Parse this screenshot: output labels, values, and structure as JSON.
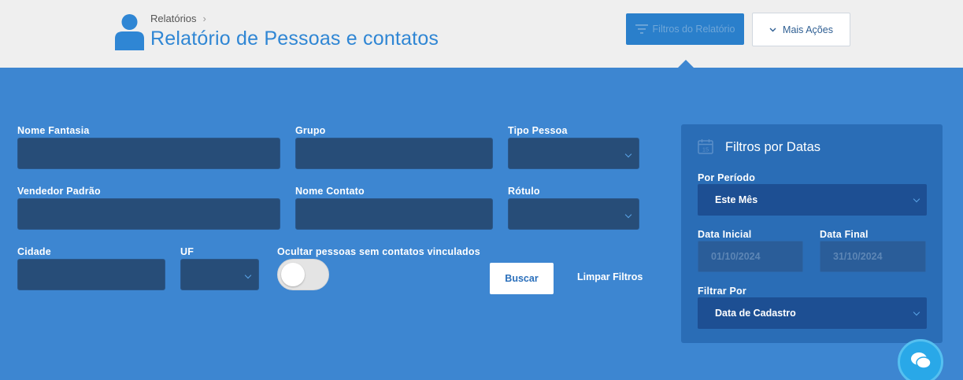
{
  "header": {
    "breadcrumb": "Relatórios",
    "title": "Relatório de Pessoas e contatos",
    "filters_button": "Filtros do Relatório",
    "more_actions_button": "Mais Ações",
    "icons": {
      "avatar": "user-icon",
      "filters": "filter-icon",
      "more": "chevron-down-icon",
      "breadcrumb_sep": "chevron-right-icon"
    }
  },
  "form": {
    "nome_fantasia": {
      "label": "Nome Fantasia",
      "value": ""
    },
    "grupo": {
      "label": "Grupo",
      "value": ""
    },
    "tipo_pessoa": {
      "label": "Tipo Pessoa",
      "value": ""
    },
    "vendedor_padrao": {
      "label": "Vendedor Padrão",
      "value": ""
    },
    "nome_contato": {
      "label": "Nome Contato",
      "value": ""
    },
    "rotulo": {
      "label": "Rótulo",
      "value": ""
    },
    "cidade": {
      "label": "Cidade",
      "value": ""
    },
    "uf": {
      "label": "UF",
      "value": ""
    },
    "ocultar": {
      "label": "Ocultar pessoas sem contatos vinculados",
      "checked": false
    },
    "buscar": "Buscar",
    "limpar": "Limpar Filtros"
  },
  "dates": {
    "title": "Filtros por Datas",
    "periodo_label": "Por Período",
    "periodo_value": "Este Mês",
    "data_inicial_label": "Data Inicial",
    "data_inicial_value": "01/10/2024",
    "data_final_label": "Data Final",
    "data_final_value": "31/10/2024",
    "filtrar_label": "Filtrar Por",
    "filtrar_value": "Data de Cadastro",
    "icon": "calendar-icon"
  },
  "colors": {
    "accent": "#3d86d1",
    "title": "#2f86d4",
    "field": "#274d78",
    "datebox": "#2a6db6"
  }
}
